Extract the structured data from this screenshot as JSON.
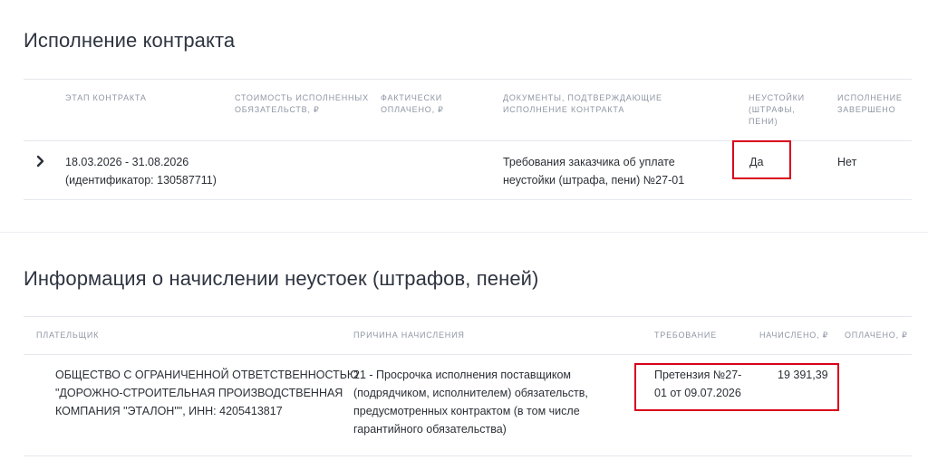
{
  "contract": {
    "title": "Исполнение контракта",
    "headers": {
      "stage": "ЭТАП КОНТРАКТА",
      "cost_line1": "СТОИМОСТЬ ИСПОЛНЕННЫХ",
      "cost_line2": "ОБЯЗАТЕЛЬСТВ, ₽",
      "paid_line1": "ФАКТИЧЕСКИ",
      "paid_line2": "ОПЛАЧЕНО, ₽",
      "docs_line1": "ДОКУМЕНТЫ, ПОДТВЕРЖДАЮЩИЕ",
      "docs_line2": "ИСПОЛНЕНИЕ КОНТРАКТА",
      "penalty_line1": "НЕУСТОЙКИ",
      "penalty_line2": "(ШТРАФЫ,",
      "penalty_line3": "ПЕНИ)",
      "done_line1": "ИСПОЛНЕНИЕ",
      "done_line2": "ЗАВЕРШЕНО"
    },
    "row": {
      "expand_glyph": "›",
      "stage_dates": "18.03.2026 - 31.08.2026",
      "stage_id": "(идентификатор: 130587711)",
      "docs_line1": "Требования заказчика об уплате",
      "docs_line2": "неустойки (штрафа, пени) №27-01",
      "penalty": "Да",
      "completed": "Нет"
    }
  },
  "penalties": {
    "title": "Информация о начислении неустоек (штрафов, пеней)",
    "headers": {
      "payer": "ПЛАТЕЛЬЩИК",
      "reason": "ПРИЧИНА НАЧИСЛЕНИЯ",
      "claim": "ТРЕБОВАНИЕ",
      "accrued": "НАЧИСЛЕНО, ₽",
      "paid": "ОПЛАЧЕНО, ₽"
    },
    "row": {
      "payer_line1": "ОБЩЕСТВО С ОГРАНИЧЕННОЙ ОТВЕТСТВЕННОСТЬЮ",
      "payer_line2": "\"ДОРОЖНО-СТРОИТЕЛЬНАЯ ПРОИЗВОДСТВЕННАЯ",
      "payer_line3": "КОМПАНИЯ \"ЭТАЛОН\"\", ИНН: 4205413817",
      "reason_line1": "21 - Просрочка исполнения поставщиком",
      "reason_line2": "(подрядчиком, исполнителем) обязательств,",
      "reason_line3": "предусмотренных контрактом (в том числе",
      "reason_line4": "гарантийного обязательства)",
      "claim_line1": "Претензия №27-",
      "claim_line2": "01 от 09.07.2026",
      "accrued": "19 391,39"
    }
  },
  "colors": {
    "highlight": "#d9001b",
    "header_text": "#8e96a3",
    "divider": "#e4e7ec"
  }
}
